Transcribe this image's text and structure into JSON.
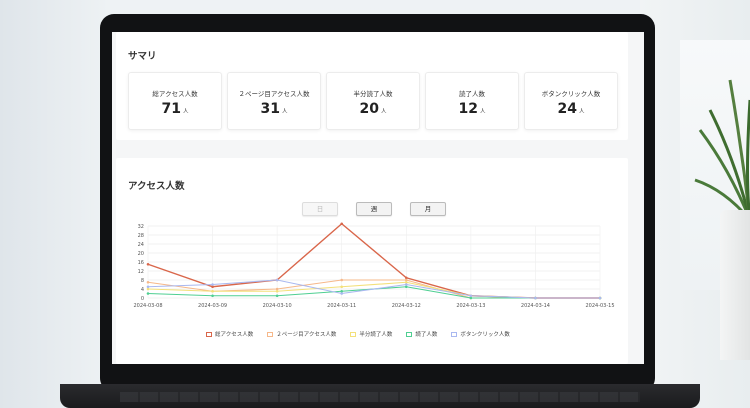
{
  "summary": {
    "title": "サマリ",
    "cards": [
      {
        "label": "総アクセス人数",
        "value": "71",
        "unit": "人"
      },
      {
        "label": "２ページ目アクセス人数",
        "value": "31",
        "unit": "人"
      },
      {
        "label": "半分読了人数",
        "value": "20",
        "unit": "人"
      },
      {
        "label": "読了人数",
        "value": "12",
        "unit": "人"
      },
      {
        "label": "ボタンクリック人数",
        "value": "24",
        "unit": "人"
      }
    ]
  },
  "access": {
    "title": "アクセス人数",
    "toggles": [
      {
        "label": "日",
        "state": "disabled"
      },
      {
        "label": "週",
        "state": "enabled"
      },
      {
        "label": "月",
        "state": "enabled"
      }
    ]
  },
  "chart_data": {
    "type": "line",
    "x": [
      "2024-03-08",
      "2024-03-09",
      "2024-03-10",
      "2024-03-11",
      "2024-03-12",
      "2024-03-13",
      "2024-03-14",
      "2024-03-15"
    ],
    "y_ticks": [
      0,
      4,
      8,
      12,
      16,
      20,
      24,
      28,
      32
    ],
    "ylim": [
      0,
      32
    ],
    "grid": true,
    "legend_position": "bottom",
    "series": [
      {
        "name": "総アクセス人数",
        "color": "#d9664a",
        "values": [
          15,
          5,
          8,
          33,
          9,
          1,
          0,
          0
        ]
      },
      {
        "name": "２ページ目アクセス人数",
        "color": "#f6b88a",
        "values": [
          7,
          3,
          4,
          8,
          8,
          0,
          0,
          0
        ]
      },
      {
        "name": "半分読了人数",
        "color": "#f3e07a",
        "values": [
          4,
          3,
          3,
          5,
          7,
          1,
          0,
          0
        ]
      },
      {
        "name": "読了人数",
        "color": "#4fcf92",
        "values": [
          2,
          1,
          1,
          3,
          5,
          0,
          0,
          0
        ]
      },
      {
        "name": "ボタンクリック人数",
        "color": "#a9b8f0",
        "values": [
          5,
          6,
          8,
          2,
          6,
          1,
          0,
          0
        ]
      }
    ]
  }
}
